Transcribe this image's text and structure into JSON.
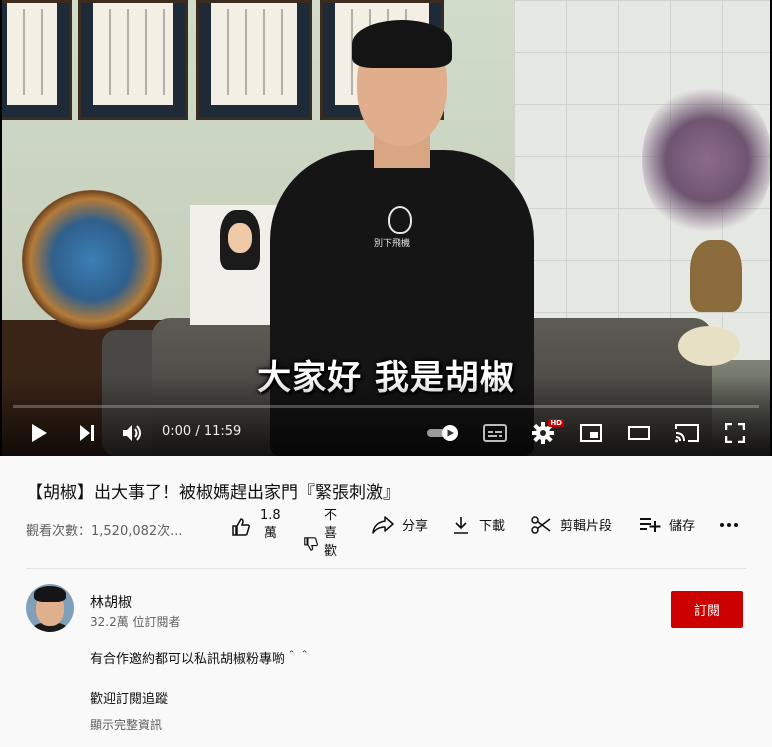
{
  "player": {
    "subtitle": "大家好 我是胡椒",
    "shirt_text": "別下飛機",
    "time": "0:00 / 11:59",
    "hd_badge": "HD",
    "icons": {
      "play": "play-icon",
      "next": "next-icon",
      "volume": "volume-icon",
      "autoplay": "autoplay-toggle-icon",
      "captions": "captions-icon",
      "settings": "gear-icon",
      "miniplayer": "miniplayer-icon",
      "theater": "theater-mode-icon",
      "cast": "cast-icon",
      "fullscreen": "fullscreen-icon"
    }
  },
  "video": {
    "title": "【胡椒】出大事了！被椒媽趕出家門『緊張刺激』",
    "views": "觀看次數：1,520,082次..."
  },
  "actions": {
    "like_count_top": "1.8",
    "like_count_bottom": "萬",
    "dislike_l1": "不",
    "dislike_l2": "喜",
    "dislike_l3": "歡",
    "share": "分享",
    "download": "下載",
    "clip": "剪輯片段",
    "save": "儲存"
  },
  "channel": {
    "name": "林胡椒",
    "subscribers": "32.2萬 位訂閱者",
    "subscribe_label": "訂閱"
  },
  "description": {
    "line1": "有合作邀約都可以私訊胡椒粉專喲＾＾",
    "line2": "歡迎訂閱追蹤",
    "show_more": "顯示完整資訊"
  },
  "colors": {
    "subscribe": "#cc0000",
    "background": "#f9f9f9",
    "text": "#0f0f0f",
    "secondary_text": "#606060"
  }
}
